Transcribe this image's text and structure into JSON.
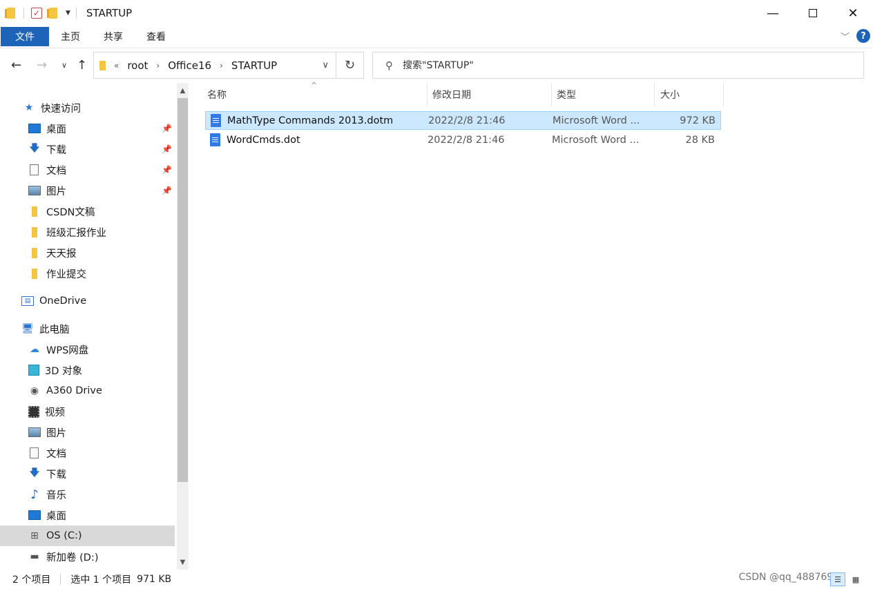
{
  "window": {
    "title": "STARTUP",
    "minimize_icon": "minimize-icon",
    "maximize_icon": "maximize-icon",
    "close_icon": "close-icon"
  },
  "ribbon": {
    "tabs": [
      {
        "label": "文件"
      },
      {
        "label": "主页"
      },
      {
        "label": "共享"
      },
      {
        "label": "查看"
      }
    ],
    "accent": "#1d64b9"
  },
  "address": {
    "overflow": "«",
    "crumbs": [
      "root",
      "Office16",
      "STARTUP"
    ]
  },
  "search": {
    "placeholder": "搜索\"STARTUP\""
  },
  "sidebar": {
    "items": [
      {
        "label": "快速访问",
        "icon": "star-icon"
      },
      {
        "label": "桌面",
        "icon": "desktop-icon",
        "pinned": true
      },
      {
        "label": "下载",
        "icon": "download-icon",
        "pinned": true
      },
      {
        "label": "文档",
        "icon": "document-icon",
        "pinned": true
      },
      {
        "label": "图片",
        "icon": "picture-icon",
        "pinned": true
      },
      {
        "label": "CSDN文稿",
        "icon": "folder-icon"
      },
      {
        "label": "班级汇报作业",
        "icon": "folder-icon"
      },
      {
        "label": "天天报",
        "icon": "folder-icon"
      },
      {
        "label": "作业提交",
        "icon": "folder-icon"
      },
      {
        "label": "OneDrive",
        "icon": "onedrive-icon"
      },
      {
        "label": "此电脑",
        "icon": "this-pc-icon"
      },
      {
        "label": "WPS网盘",
        "icon": "cloud-icon"
      },
      {
        "label": "3D 对象",
        "icon": "3d-objects-icon"
      },
      {
        "label": "A360 Drive",
        "icon": "a360-icon"
      },
      {
        "label": "视频",
        "icon": "video-icon"
      },
      {
        "label": "图片",
        "icon": "picture-icon"
      },
      {
        "label": "文档",
        "icon": "document-icon"
      },
      {
        "label": "下载",
        "icon": "download-icon"
      },
      {
        "label": "音乐",
        "icon": "music-icon"
      },
      {
        "label": "桌面",
        "icon": "desktop-icon"
      },
      {
        "label": "OS (C:)",
        "icon": "os-drive-icon",
        "selected": true
      },
      {
        "label": "新加卷 (D:)",
        "icon": "drive-icon"
      }
    ]
  },
  "columns": {
    "name": "名称",
    "date": "修改日期",
    "type": "类型",
    "size": "大小"
  },
  "files": [
    {
      "name": "MathType Commands 2013.dotm",
      "date": "2022/2/8 21:46",
      "type": "Microsoft Word ...",
      "size": "972 KB",
      "selected": true
    },
    {
      "name": "WordCmds.dot",
      "date": "2022/2/8 21:46",
      "type": "Microsoft Word ...",
      "size": "28 KB",
      "selected": false
    }
  ],
  "status": {
    "count": "2 个项目",
    "selection": "选中 1 个项目",
    "size": "971 KB",
    "watermark": "CSDN @qq_48876918"
  }
}
